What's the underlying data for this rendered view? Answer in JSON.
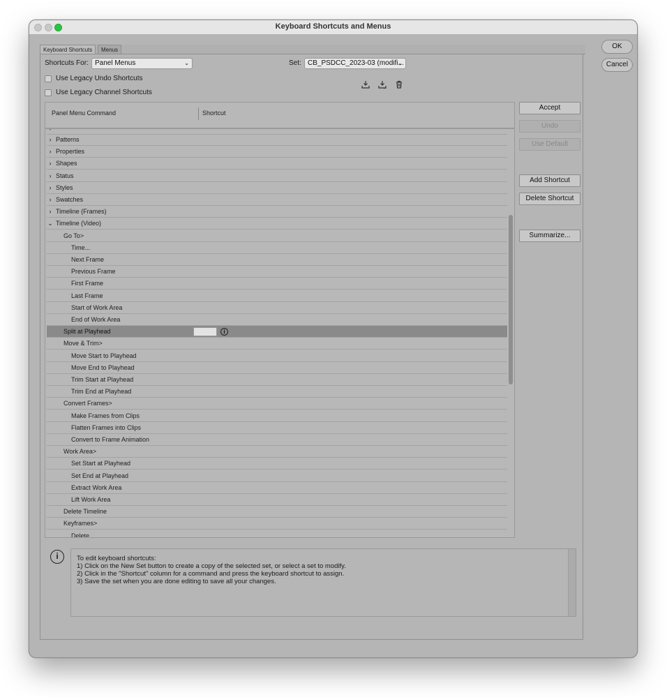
{
  "window": {
    "title": "Keyboard Shortcuts and Menus"
  },
  "tabs": [
    {
      "label": "Keyboard Shortcuts",
      "active": true
    },
    {
      "label": "Menus",
      "active": false
    }
  ],
  "shortcuts_for": {
    "label": "Shortcuts For:",
    "value": "Panel Menus"
  },
  "set": {
    "label": "Set:",
    "value": "CB_PSDCC_2023-03 (modifi..."
  },
  "checkboxes": [
    {
      "label": "Use Legacy Undo Shortcuts",
      "checked": false
    },
    {
      "label": "Use Legacy Channel Shortcuts",
      "checked": false
    }
  ],
  "set_icons": [
    "save-set-icon",
    "new-set-icon",
    "delete-set-icon"
  ],
  "table": {
    "col_command": "Panel Menu Command",
    "col_shortcut": "Shortcut",
    "rows": [
      {
        "label": "Patterns",
        "level": 0,
        "arrow": "›"
      },
      {
        "label": "Properties",
        "level": 0,
        "arrow": "›"
      },
      {
        "label": "Shapes",
        "level": 0,
        "arrow": "›"
      },
      {
        "label": "Status",
        "level": 0,
        "arrow": "›"
      },
      {
        "label": "Styles",
        "level": 0,
        "arrow": "›"
      },
      {
        "label": "Swatches",
        "level": 0,
        "arrow": "›"
      },
      {
        "label": "Timeline (Frames)",
        "level": 0,
        "arrow": "›"
      },
      {
        "label": "Timeline (Video)",
        "level": 0,
        "arrow": "⌄"
      },
      {
        "label": "Go To>",
        "level": 1
      },
      {
        "label": "Time...",
        "level": 2
      },
      {
        "label": "Next Frame",
        "level": 2
      },
      {
        "label": "Previous Frame",
        "level": 2
      },
      {
        "label": "First Frame",
        "level": 2
      },
      {
        "label": "Last Frame",
        "level": 2
      },
      {
        "label": "Start of Work Area",
        "level": 2
      },
      {
        "label": "End of Work Area",
        "level": 2
      },
      {
        "label": "Split at Playhead",
        "level": 1,
        "selected": true
      },
      {
        "label": "Move & Trim>",
        "level": 1
      },
      {
        "label": "Move Start to Playhead",
        "level": 2
      },
      {
        "label": "Move End to Playhead",
        "level": 2
      },
      {
        "label": "Trim Start at Playhead",
        "level": 2
      },
      {
        "label": "Trim End at Playhead",
        "level": 2
      },
      {
        "label": "Convert Frames>",
        "level": 1
      },
      {
        "label": "Make Frames from Clips",
        "level": 2
      },
      {
        "label": "Flatten Frames into Clips",
        "level": 2
      },
      {
        "label": "Convert to Frame Animation",
        "level": 2
      },
      {
        "label": "Work Area>",
        "level": 1
      },
      {
        "label": "Set Start at Playhead",
        "level": 2
      },
      {
        "label": "Set End at Playhead",
        "level": 2
      },
      {
        "label": "Extract Work Area",
        "level": 2
      },
      {
        "label": "Lift Work Area",
        "level": 2
      },
      {
        "label": "Delete Timeline",
        "level": 1
      },
      {
        "label": "Keyframes>",
        "level": 1
      },
      {
        "label": "Delete",
        "level": 2
      }
    ]
  },
  "side_buttons": {
    "accept": "Accept",
    "undo": "Undo",
    "use_default": "Use Default",
    "add_shortcut": "Add Shortcut",
    "delete_shortcut": "Delete Shortcut",
    "summarize": "Summarize..."
  },
  "dialog_buttons": {
    "ok": "OK",
    "cancel": "Cancel"
  },
  "info": {
    "lines": [
      "To edit keyboard shortcuts:",
      "1) Click on the New Set button to create a copy of the selected set, or select a set to modify.",
      "2) Click in the \"Shortcut\" column for a command and press the keyboard shortcut to assign.",
      "3) Save the set when you are done editing to save all your changes."
    ]
  }
}
